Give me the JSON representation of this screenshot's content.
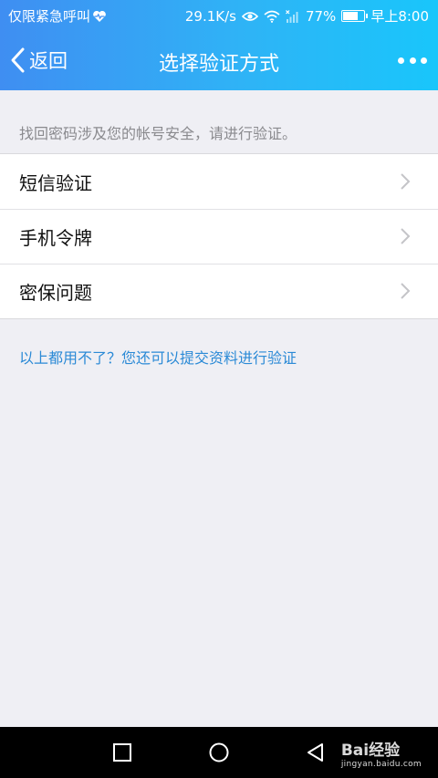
{
  "status_bar": {
    "carrier_text": "仅限紧急呼叫",
    "net_speed": "29.1K/s",
    "battery_percent": "77%",
    "battery_level": 0.77,
    "time": "早上8:00"
  },
  "header": {
    "back_label": "返回",
    "title": "选择验证方式"
  },
  "hint": "找回密码涉及您的帐号安全，请进行验证。",
  "options": [
    {
      "label": "短信验证"
    },
    {
      "label": "手机令牌"
    },
    {
      "label": "密保问题"
    }
  ],
  "alternative_link": "以上都用不了？您还可以提交资料进行验证",
  "watermark": {
    "main": "Bai经验",
    "sub": "jingyan.baidu.com"
  },
  "colors": {
    "header_gradient_start": "#3f8ef2",
    "header_gradient_end": "#19c6fb",
    "link": "#2b8ad6",
    "background": "#efeff4"
  }
}
